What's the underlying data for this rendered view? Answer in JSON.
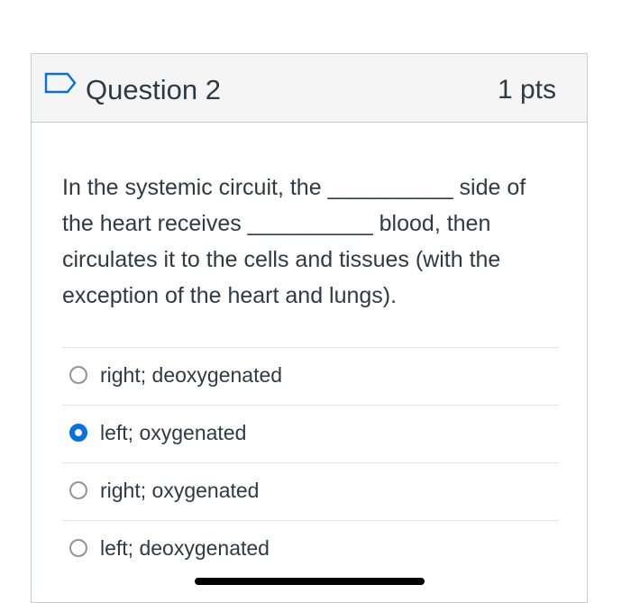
{
  "question": {
    "title": "Question 2",
    "points": "1 pts",
    "text": "In the systemic circuit, the __________ side of the heart receives __________ blood, then circulates it to the cells and tissues (with the exception of the heart and lungs).",
    "flag_icon": "flag-outline-icon"
  },
  "answers": [
    {
      "label": "right; deoxygenated",
      "selected": false
    },
    {
      "label": "left; oxygenated",
      "selected": true
    },
    {
      "label": "right; oxygenated",
      "selected": false
    },
    {
      "label": "left; deoxygenated",
      "selected": false
    }
  ],
  "colors": {
    "accent": "#0770e3",
    "text": "#2d3b45",
    "header_bg": "#f5f5f5",
    "border": "#c7cdd1"
  }
}
